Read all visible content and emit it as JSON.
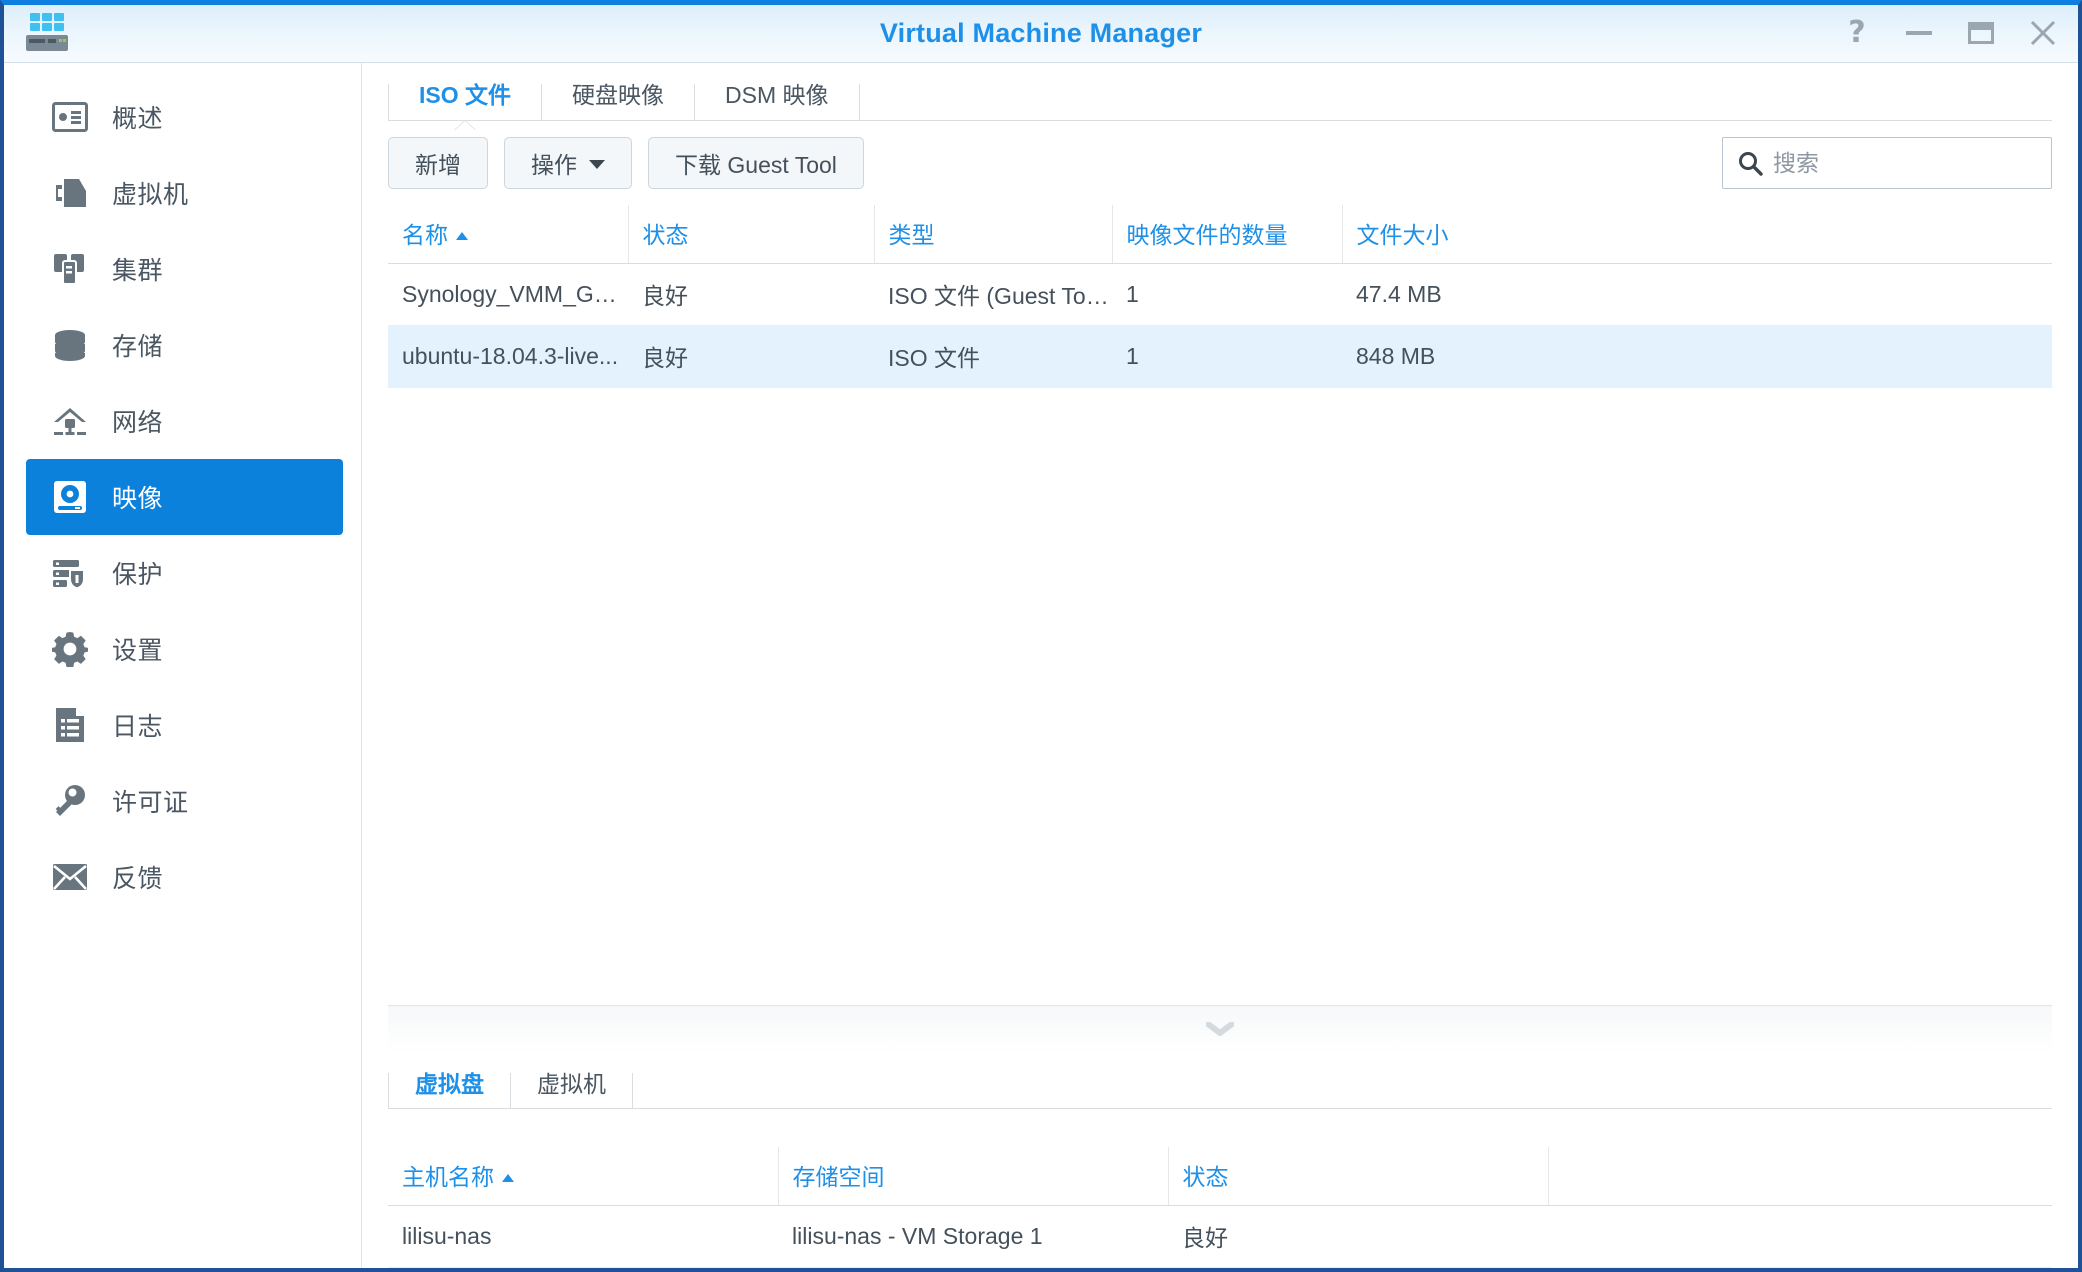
{
  "window": {
    "title": "Virtual Machine Manager",
    "accent": "#0c81dc",
    "title_color": "#1e90e8",
    "ok_color": "#2aa21a",
    "controls": [
      {
        "name": "help-button",
        "label": "?"
      },
      {
        "name": "minimize-button",
        "label": "—"
      },
      {
        "name": "maximize-button",
        "label": "□"
      },
      {
        "name": "close-button",
        "label": "✕"
      }
    ]
  },
  "sidebar": {
    "items": [
      {
        "label": "概述",
        "icon": "overview-icon",
        "active": false
      },
      {
        "label": "虚拟机",
        "icon": "vm-icon",
        "active": false
      },
      {
        "label": "集群",
        "icon": "cluster-icon",
        "active": false
      },
      {
        "label": "存储",
        "icon": "storage-icon",
        "active": false
      },
      {
        "label": "网络",
        "icon": "network-icon",
        "active": false
      },
      {
        "label": "映像",
        "icon": "image-icon",
        "active": true
      },
      {
        "label": "保护",
        "icon": "protection-icon",
        "active": false
      },
      {
        "label": "设置",
        "icon": "gear-icon",
        "active": false
      },
      {
        "label": "日志",
        "icon": "log-icon",
        "active": false
      },
      {
        "label": "许可证",
        "icon": "key-icon",
        "active": false
      },
      {
        "label": "反馈",
        "icon": "mail-icon",
        "active": false
      }
    ]
  },
  "main": {
    "tabs": [
      {
        "label": "ISO 文件",
        "active": true
      },
      {
        "label": "硬盘映像",
        "active": false
      },
      {
        "label": "DSM 映像",
        "active": false
      }
    ],
    "toolbar": {
      "add_label": "新增",
      "action_label": "操作",
      "download_guest_tool_label": "下载 Guest Tool"
    },
    "search": {
      "placeholder": "搜索",
      "value": "",
      "icon": "search-icon"
    },
    "table": {
      "columns": [
        {
          "label": "名称",
          "sorted": "asc"
        },
        {
          "label": "状态",
          "sorted": ""
        },
        {
          "label": "类型",
          "sorted": ""
        },
        {
          "label": "映像文件的数量",
          "sorted": ""
        },
        {
          "label": "文件大小",
          "sorted": ""
        }
      ],
      "rows": [
        {
          "name": "Synology_VMM_Gue...",
          "status": "良好",
          "type": "ISO 文件 (Guest Tool...",
          "count": "1",
          "size": "47.4 MB",
          "selected": false
        },
        {
          "name": "ubuntu-18.04.3-live...",
          "status": "良好",
          "type": "ISO 文件",
          "count": "1",
          "size": "848 MB",
          "selected": true
        }
      ]
    }
  },
  "bottom": {
    "collapse_icon": "chevron-down-icon",
    "tabs": [
      {
        "label": "虚拟盘",
        "active": true
      },
      {
        "label": "虚拟机",
        "active": false
      }
    ],
    "table": {
      "columns": [
        {
          "label": "主机名称",
          "sorted": "asc"
        },
        {
          "label": "存储空间",
          "sorted": ""
        },
        {
          "label": "状态",
          "sorted": ""
        },
        {
          "label": "",
          "sorted": ""
        }
      ],
      "rows": [
        {
          "host": "lilisu-nas",
          "storage": "lilisu-nas - VM Storage 1",
          "status": "良好",
          "extra": ""
        }
      ]
    }
  }
}
